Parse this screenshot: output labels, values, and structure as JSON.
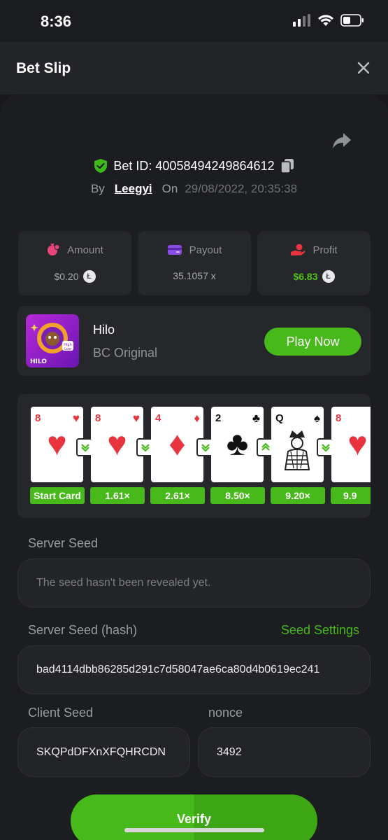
{
  "status_bar": {
    "time": "8:36"
  },
  "header": {
    "title": "Bet Slip"
  },
  "bet": {
    "id_label": "Bet ID: 40058494249864612",
    "by_label": "By",
    "user": "Leegyi",
    "on_label": "On",
    "date": "29/08/2022, 20:35:38"
  },
  "stats": [
    {
      "label": "Amount",
      "value": "$0.20",
      "icon": "money-bag-icon",
      "color": "#e8457a"
    },
    {
      "label": "Payout",
      "value": "35.1057 x",
      "icon": "wallet-icon",
      "color": "#8b4be6"
    },
    {
      "label": "Profit",
      "value": "$6.83",
      "icon": "hand-coin-icon",
      "color": "#e8343e"
    }
  ],
  "game": {
    "name": "Hilo",
    "subtitle": "BC Original",
    "play_label": "Play Now",
    "thumb_text": "HILO",
    "badge_high": "High",
    "badge_low": "Low"
  },
  "cards": [
    {
      "rank": "8",
      "suit": "♥",
      "color": "red",
      "multiplier": "Start Card",
      "arrow": "down"
    },
    {
      "rank": "8",
      "suit": "♥",
      "color": "red",
      "multiplier": "1.61×",
      "arrow": "down"
    },
    {
      "rank": "4",
      "suit": "♦",
      "color": "red",
      "multiplier": "2.61×",
      "arrow": "down"
    },
    {
      "rank": "2",
      "suit": "♣",
      "color": "black",
      "multiplier": "8.50×",
      "arrow": "up"
    },
    {
      "rank": "Q",
      "suit": "♠",
      "color": "black",
      "multiplier": "9.20×",
      "arrow": "down"
    },
    {
      "rank": "8",
      "suit": "♥",
      "color": "red",
      "multiplier": "9.9",
      "arrow": ""
    }
  ],
  "seeds": {
    "server_label": "Server Seed",
    "server_value": "The seed hasn't been revealed yet.",
    "hash_label": "Server Seed (hash)",
    "settings_label": "Seed Settings",
    "hash_value": "bad4114dbb86285d291c7d58047ae6ca80d4b0619ec241",
    "client_label": "Client Seed",
    "client_value": "SKQPdDFXnXFQHRCDN",
    "nonce_label": "nonce",
    "nonce_value": "3492"
  },
  "verify_label": "Verify"
}
